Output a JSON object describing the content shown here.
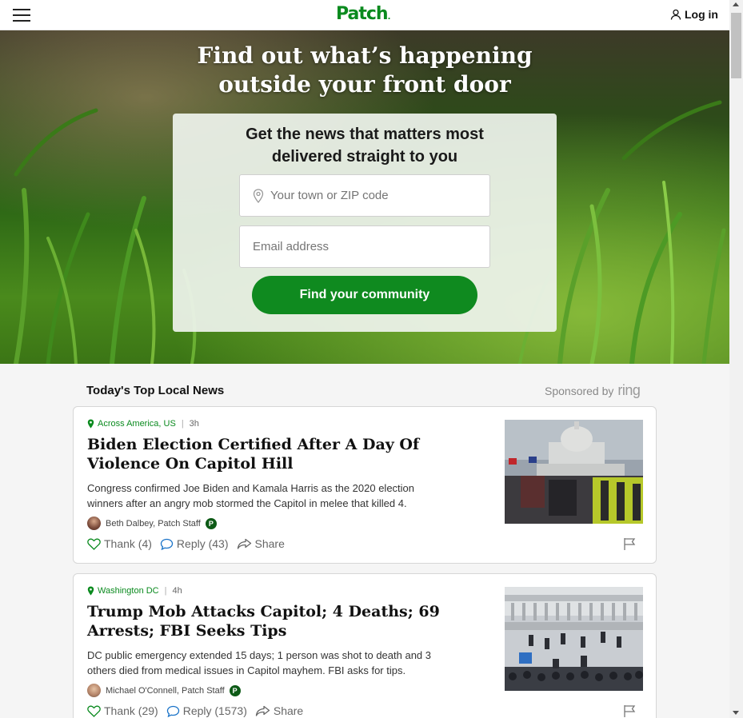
{
  "header": {
    "logo": "Patch",
    "login_label": "Log in"
  },
  "hero": {
    "headline_line1": "Find out what’s happening",
    "headline_line2": "outside your front door",
    "signup_title_line1": "Get the news that matters most",
    "signup_title_line2": "delivered straight to you",
    "town_placeholder": "Your town or ZIP code",
    "email_placeholder": "Email address",
    "cta_label": "Find your community"
  },
  "section": {
    "title": "Today's Top Local News",
    "sponsored_label": "Sponsored by",
    "sponsor_name": "ring"
  },
  "articles": [
    {
      "location": "Across America, US",
      "age": "3h",
      "headline_line1": "Biden Election Certified After A Day Of",
      "headline_line2": "Violence On Capitol Hill",
      "summary_line1": "Congress confirmed Joe Biden and Kamala Harris as the 2020 election",
      "summary_line2": "winners after an angry mob stormed the Capitol in melee that killed 4.",
      "author": "Beth Dalbey, Patch Staff",
      "badge": "P",
      "thank_label": "Thank (4)",
      "reply_label": "Reply (43)",
      "share_label": "Share"
    },
    {
      "location": "Washington DC",
      "age": "4h",
      "headline_line1": "Trump Mob Attacks Capitol; 4 Deaths; 69",
      "headline_line2": "Arrests; FBI Seeks Tips",
      "summary_line1": "DC public emergency extended 15 days; 1 person was shot to death and 3",
      "summary_line2": "others died from medical issues in Capitol mayhem. FBI asks for tips.",
      "author": "Michael O'Connell, Patch Staff",
      "badge": "P",
      "thank_label": "Thank (29)",
      "reply_label": "Reply (1573)",
      "share_label": "Share"
    }
  ],
  "colors": {
    "brand_green": "#0a8a1e",
    "cta_green": "#0f8a1f"
  }
}
